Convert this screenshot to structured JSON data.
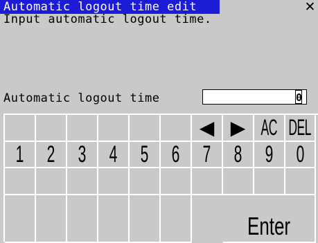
{
  "dialog": {
    "title": "Automatic logout time edit",
    "close_glyph": "✕",
    "instruction": "Input automatic logout time."
  },
  "field": {
    "label": "Automatic logout time",
    "value": "0"
  },
  "keypad": {
    "row1": [
      "",
      "",
      "",
      "",
      "",
      "",
      "◀",
      "▶",
      "AC",
      "DEL"
    ],
    "row2": [
      "1",
      "2",
      "3",
      "4",
      "5",
      "6",
      "7",
      "8",
      "9",
      "0"
    ],
    "row3": [
      "",
      "",
      "",
      "",
      "",
      "",
      "",
      "",
      "",
      ""
    ],
    "row4": [
      "",
      "",
      "",
      "",
      "",
      "",
      "Enter"
    ]
  }
}
